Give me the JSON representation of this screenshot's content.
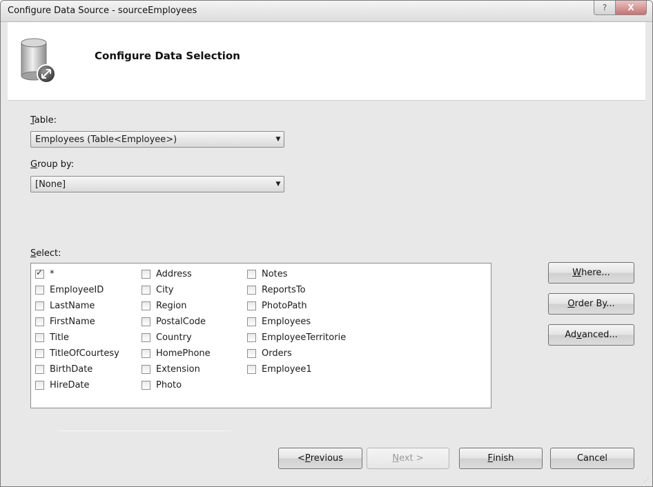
{
  "window": {
    "title": "Configure Data Source - sourceEmployees",
    "help_glyph": "?",
    "close_glyph": "X"
  },
  "header": {
    "title": "Configure Data Selection",
    "icon": "database-wizard-icon"
  },
  "table": {
    "label_accel": "T",
    "label_rest": "able:",
    "value": "Employees (Table<Employee>)"
  },
  "group_by": {
    "label_accel": "G",
    "label_rest": "roup by:",
    "value": "[None]"
  },
  "select": {
    "label_accel": "S",
    "label_rest": "elect:",
    "columns": [
      [
        {
          "label": "*",
          "checked": true
        },
        {
          "label": "EmployeeID",
          "checked": false
        },
        {
          "label": "LastName",
          "checked": false
        },
        {
          "label": "FirstName",
          "checked": false
        },
        {
          "label": "Title",
          "checked": false
        },
        {
          "label": "TitleOfCourtesy",
          "checked": false
        },
        {
          "label": "BirthDate",
          "checked": false
        },
        {
          "label": "HireDate",
          "checked": false
        }
      ],
      [
        {
          "label": "Address",
          "checked": false
        },
        {
          "label": "City",
          "checked": false
        },
        {
          "label": "Region",
          "checked": false
        },
        {
          "label": "PostalCode",
          "checked": false
        },
        {
          "label": "Country",
          "checked": false
        },
        {
          "label": "HomePhone",
          "checked": false
        },
        {
          "label": "Extension",
          "checked": false
        },
        {
          "label": "Photo",
          "checked": false
        }
      ],
      [
        {
          "label": "Notes",
          "checked": false
        },
        {
          "label": "ReportsTo",
          "checked": false
        },
        {
          "label": "PhotoPath",
          "checked": false
        },
        {
          "label": "Employees",
          "checked": false
        },
        {
          "label": "EmployeeTerritorie",
          "checked": false
        },
        {
          "label": "Orders",
          "checked": false
        },
        {
          "label": "Employee1",
          "checked": false
        }
      ]
    ]
  },
  "side_buttons": {
    "where": {
      "accel": "W",
      "rest": "here..."
    },
    "order_by": {
      "accel": "O",
      "rest": "rder By..."
    },
    "advanced": {
      "pre": "Ad",
      "accel": "v",
      "rest": "anced..."
    }
  },
  "footer": {
    "previous": {
      "pre": "< ",
      "accel": "P",
      "rest": "revious"
    },
    "next": {
      "accel": "N",
      "rest": "ext >"
    },
    "finish": {
      "accel": "F",
      "rest": "inish"
    },
    "cancel": "Cancel"
  }
}
